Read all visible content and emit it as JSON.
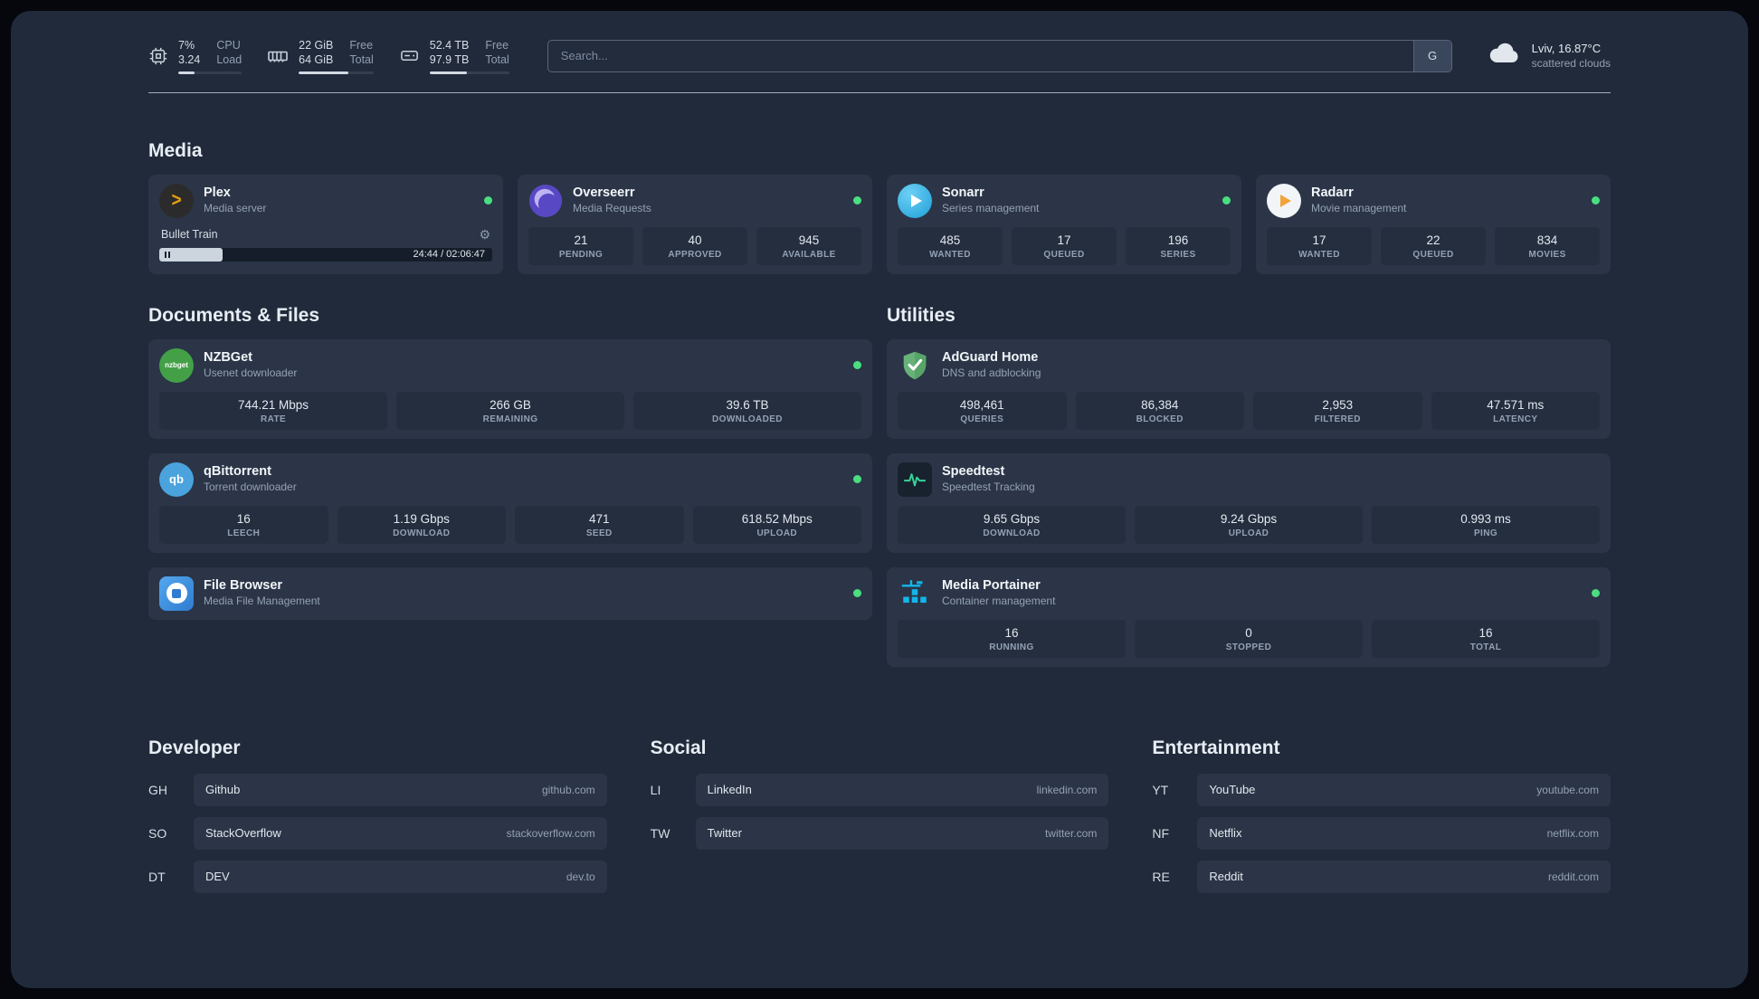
{
  "topbar": {
    "cpu": {
      "value_top": "7%",
      "value_bottom": "3.24",
      "label_top": "CPU",
      "label_bottom": "Load",
      "progress": 25
    },
    "memory": {
      "value_top": "22 GiB",
      "value_bottom": "64 GiB",
      "label_top": "Free",
      "label_bottom": "Total",
      "progress": 66
    },
    "disk": {
      "value_top": "52.4 TB",
      "value_bottom": "97.9 TB",
      "label_top": "Free",
      "label_bottom": "Total",
      "progress": 47
    },
    "search": {
      "placeholder": "Search...",
      "button_label": "G"
    },
    "weather": {
      "location": "Lviv, 16.87°C",
      "condition": "scattered clouds"
    }
  },
  "media": {
    "title": "Media",
    "plex": {
      "name": "Plex",
      "desc": "Media server",
      "player": {
        "track": "Bullet Train",
        "time": "24:44 / 02:06:47",
        "progress": 19
      }
    },
    "overseerr": {
      "name": "Overseerr",
      "desc": "Media Requests",
      "stats": [
        {
          "value": "21",
          "label": "PENDING"
        },
        {
          "value": "40",
          "label": "APPROVED"
        },
        {
          "value": "945",
          "label": "AVAILABLE"
        }
      ]
    },
    "sonarr": {
      "name": "Sonarr",
      "desc": "Series management",
      "stats": [
        {
          "value": "485",
          "label": "WANTED"
        },
        {
          "value": "17",
          "label": "QUEUED"
        },
        {
          "value": "196",
          "label": "SERIES"
        }
      ]
    },
    "radarr": {
      "name": "Radarr",
      "desc": "Movie management",
      "stats": [
        {
          "value": "17",
          "label": "WANTED"
        },
        {
          "value": "22",
          "label": "QUEUED"
        },
        {
          "value": "834",
          "label": "MOVIES"
        }
      ]
    }
  },
  "documents": {
    "title": "Documents & Files",
    "nzbget": {
      "name": "NZBGet",
      "desc": "Usenet downloader",
      "icon_text": "nzbget",
      "stats": [
        {
          "value": "744.21 Mbps",
          "label": "RATE"
        },
        {
          "value": "266 GB",
          "label": "REMAINING"
        },
        {
          "value": "39.6 TB",
          "label": "DOWNLOADED"
        }
      ]
    },
    "qbittorrent": {
      "name": "qBittorrent",
      "desc": "Torrent downloader",
      "icon_text": "qb",
      "stats": [
        {
          "value": "16",
          "label": "LEECH"
        },
        {
          "value": "1.19 Gbps",
          "label": "DOWNLOAD"
        },
        {
          "value": "471",
          "label": "SEED"
        },
        {
          "value": "618.52 Mbps",
          "label": "UPLOAD"
        }
      ]
    },
    "filebrowser": {
      "name": "File Browser",
      "desc": "Media File Management"
    }
  },
  "utilities": {
    "title": "Utilities",
    "adguard": {
      "name": "AdGuard Home",
      "desc": "DNS and adblocking",
      "stats": [
        {
          "value": "498,461",
          "label": "QUERIES"
        },
        {
          "value": "86,384",
          "label": "BLOCKED"
        },
        {
          "value": "2,953",
          "label": "FILTERED"
        },
        {
          "value": "47.571 ms",
          "label": "LATENCY"
        }
      ]
    },
    "speedtest": {
      "name": "Speedtest",
      "desc": "Speedtest Tracking",
      "stats": [
        {
          "value": "9.65 Gbps",
          "label": "DOWNLOAD"
        },
        {
          "value": "9.24 Gbps",
          "label": "UPLOAD"
        },
        {
          "value": "0.993 ms",
          "label": "PING"
        }
      ]
    },
    "portainer": {
      "name": "Media Portainer",
      "desc": "Container management",
      "stats": [
        {
          "value": "16",
          "label": "RUNNING"
        },
        {
          "value": "0",
          "label": "STOPPED"
        },
        {
          "value": "16",
          "label": "TOTAL"
        }
      ]
    }
  },
  "bookmarks": [
    {
      "title": "Developer",
      "items": [
        {
          "abbr": "GH",
          "name": "Github",
          "url": "github.com"
        },
        {
          "abbr": "SO",
          "name": "StackOverflow",
          "url": "stackoverflow.com"
        },
        {
          "abbr": "DT",
          "name": "DEV",
          "url": "dev.to"
        }
      ]
    },
    {
      "title": "Social",
      "items": [
        {
          "abbr": "LI",
          "name": "LinkedIn",
          "url": "linkedin.com"
        },
        {
          "abbr": "TW",
          "name": "Twitter",
          "url": "twitter.com"
        }
      ]
    },
    {
      "title": "Entertainment",
      "items": [
        {
          "abbr": "YT",
          "name": "YouTube",
          "url": "youtube.com"
        },
        {
          "abbr": "NF",
          "name": "Netflix",
          "url": "netflix.com"
        },
        {
          "abbr": "RE",
          "name": "Reddit",
          "url": "reddit.com"
        }
      ]
    }
  ],
  "colors": {
    "status_ok": "#4ade80",
    "accent_plex": "#e5a00d",
    "speedtest_line": "#34d399"
  }
}
